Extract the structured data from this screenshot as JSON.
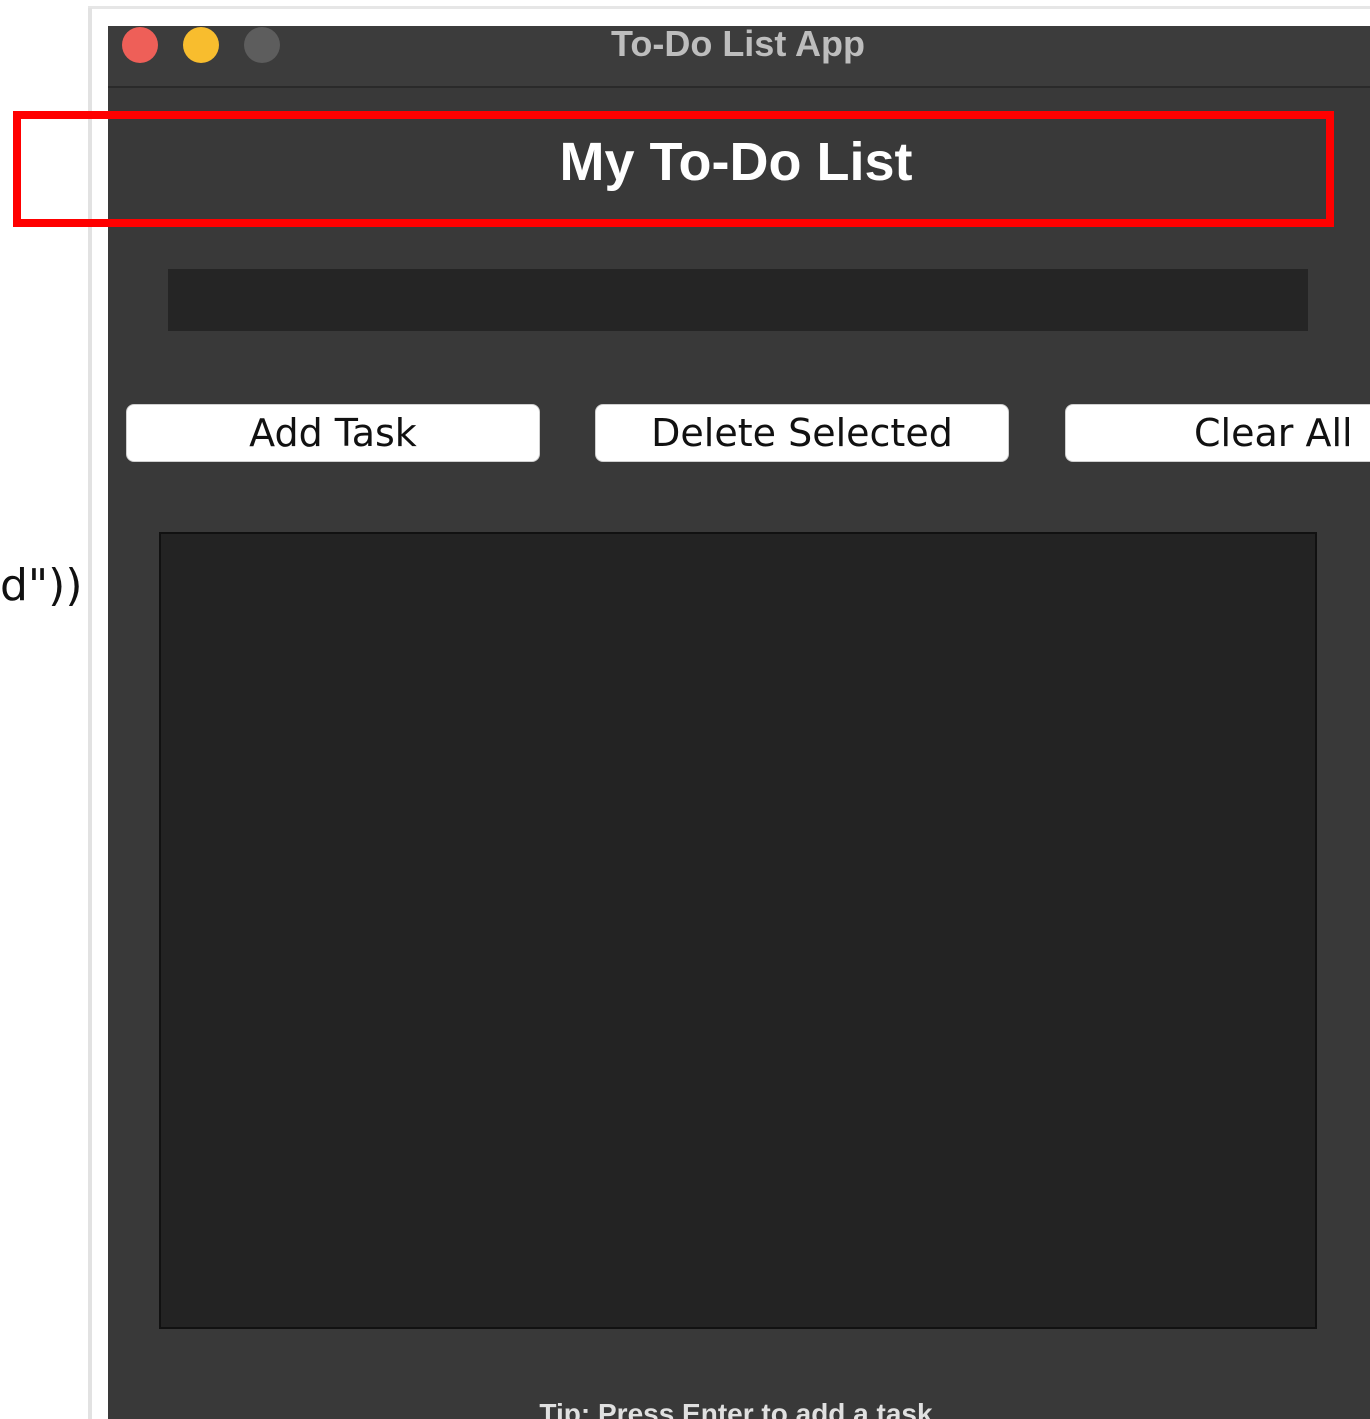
{
  "background": {
    "code_fragment": "d\"))"
  },
  "window": {
    "title": "To-Do List App",
    "controls": {
      "close_color": "#ee5f58",
      "minimize_color": "#f8bd2e",
      "zoom_color": "#5d5d5d"
    }
  },
  "app": {
    "heading": "My To-Do List",
    "task_input": {
      "value": "",
      "placeholder": ""
    },
    "buttons": {
      "add_label": "Add Task",
      "delete_label": "Delete Selected",
      "clear_label": "Clear All"
    },
    "task_list": {
      "items": []
    },
    "tip": "Tip: Press Enter to add a task"
  },
  "annotation": {
    "highlight_color": "#ff0000"
  }
}
